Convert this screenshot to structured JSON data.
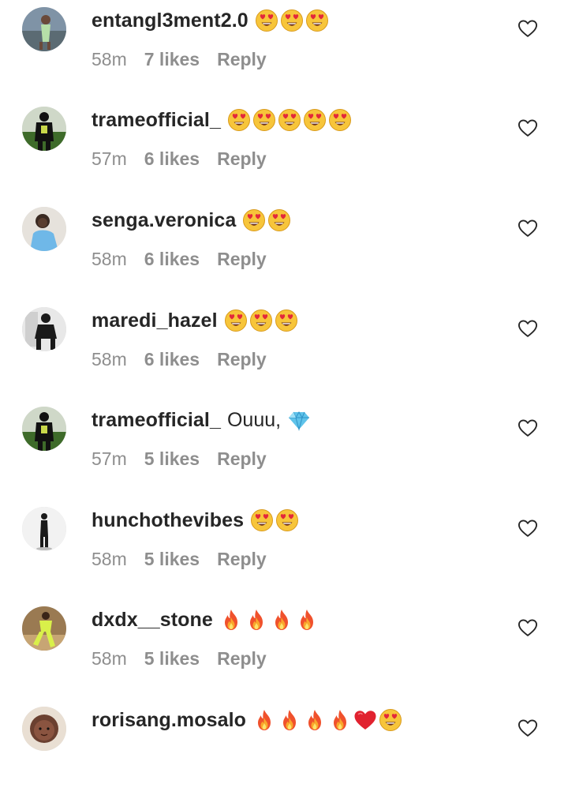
{
  "comments": [
    {
      "username": "entangl3ment2.0",
      "text": "",
      "emojis": [
        "heart-eyes",
        "heart-eyes",
        "heart-eyes"
      ],
      "time": "58m",
      "likes": "7 likes",
      "reply": "Reply",
      "avatar": "avatar-photo-1"
    },
    {
      "username": "trameofficial_",
      "text": "",
      "emojis": [
        "heart-eyes",
        "heart-eyes",
        "heart-eyes",
        "heart-eyes",
        "heart-eyes"
      ],
      "time": "57m",
      "likes": "6 likes",
      "reply": "Reply",
      "avatar": "avatar-photo-2"
    },
    {
      "username": "senga.veronica",
      "text": "",
      "emojis": [
        "heart-eyes",
        "heart-eyes"
      ],
      "time": "58m",
      "likes": "6 likes",
      "reply": "Reply",
      "avatar": "avatar-photo-3"
    },
    {
      "username": "maredi_hazel",
      "text": "",
      "emojis": [
        "heart-eyes",
        "heart-eyes",
        "heart-eyes"
      ],
      "time": "58m",
      "likes": "6 likes",
      "reply": "Reply",
      "avatar": "avatar-photo-4"
    },
    {
      "username": "trameofficial_",
      "text": "Ouuu,",
      "emojis": [
        "gem"
      ],
      "time": "57m",
      "likes": "5 likes",
      "reply": "Reply",
      "avatar": "avatar-photo-2"
    },
    {
      "username": "hunchothevibes",
      "text": "",
      "emojis": [
        "heart-eyes",
        "heart-eyes"
      ],
      "time": "58m",
      "likes": "5 likes",
      "reply": "Reply",
      "avatar": "avatar-photo-5"
    },
    {
      "username": "dxdx__stone",
      "text": "",
      "emojis": [
        "fire",
        "fire",
        "fire",
        "fire"
      ],
      "time": "58m",
      "likes": "5 likes",
      "reply": "Reply",
      "avatar": "avatar-photo-6"
    },
    {
      "username": "rorisang.mosalo",
      "text": "",
      "emojis": [
        "fire",
        "fire",
        "fire",
        "fire",
        "red-heart",
        "heart-eyes"
      ],
      "time": "",
      "likes": "",
      "reply": "",
      "avatar": "avatar-photo-7"
    }
  ],
  "icons": {
    "like": "heart-outline-icon"
  },
  "colors": {
    "username": "#262626",
    "meta": "#8e8e8e",
    "heart_outline": "#262626"
  }
}
